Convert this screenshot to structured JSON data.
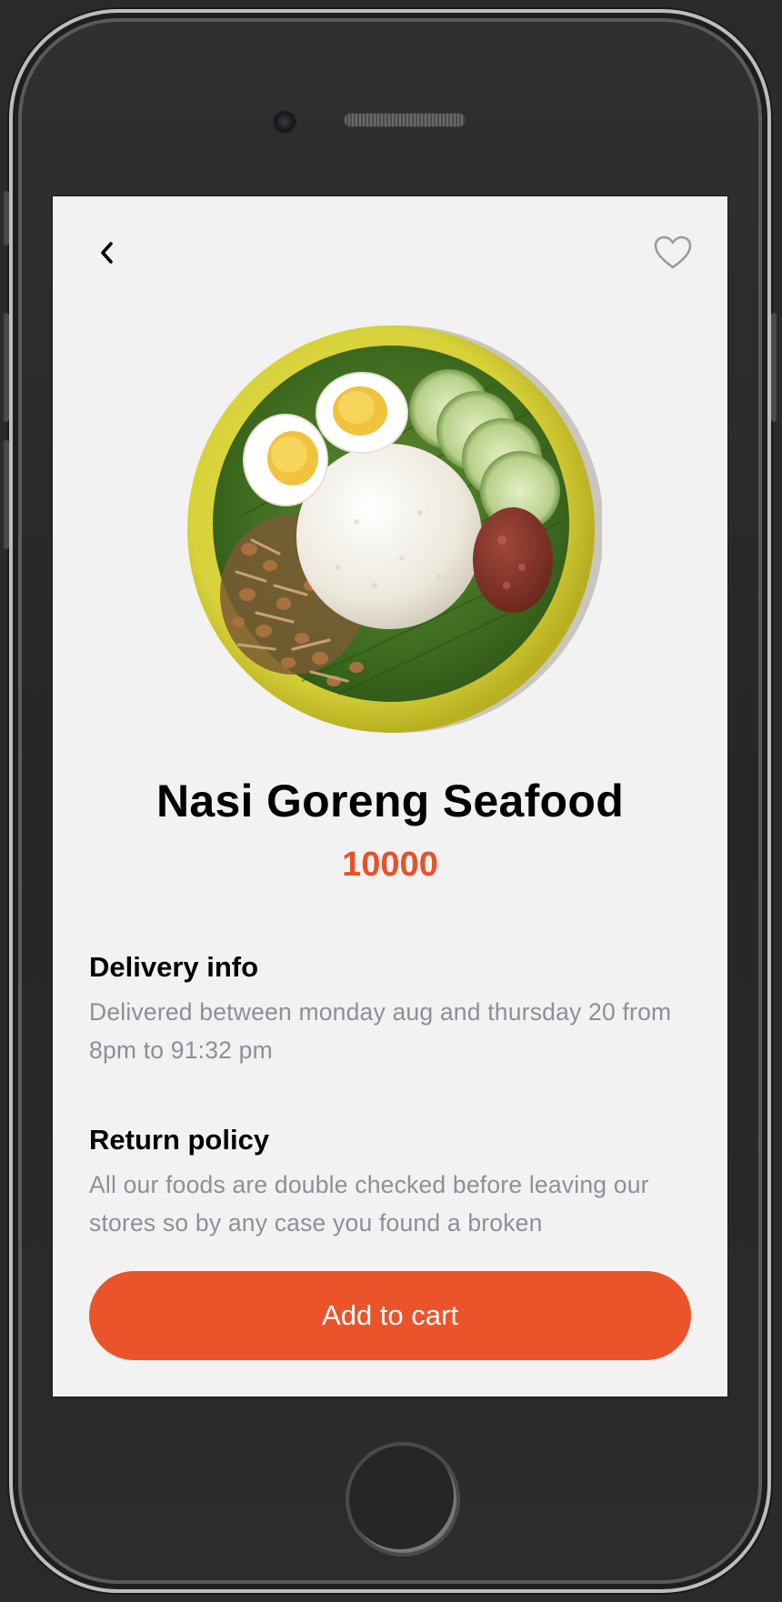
{
  "header": {
    "back_icon": "chevron-left-icon",
    "favorite_icon": "heart-outline-icon"
  },
  "product": {
    "name": "Nasi Goreng Seafood",
    "price": "10000"
  },
  "delivery": {
    "heading": "Delivery info",
    "body": "Delivered between monday aug and thursday 20 from 8pm to 91:32 pm"
  },
  "return_policy": {
    "heading": "Return policy",
    "body": "All our foods are double checked before leaving our stores so by any case you found a broken"
  },
  "actions": {
    "add_to_cart_label": "Add to cart"
  },
  "colors": {
    "accent": "#eb532b",
    "price": "#e8512b",
    "background": "#f2f2f2",
    "muted_text": "#8e8e9a"
  }
}
